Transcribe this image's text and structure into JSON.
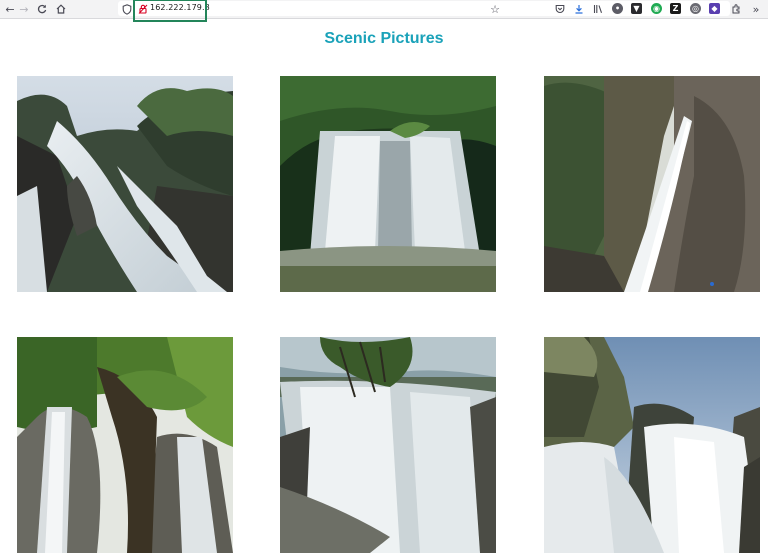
{
  "browser": {
    "url": "162.222.179.8",
    "nav_icons": [
      "back-arrow-icon",
      "forward-arrow-icon",
      "reload-icon",
      "home-icon"
    ],
    "toolbar_icons": [
      "shield-icon",
      "lock-icon",
      "bookmark-star-icon",
      "pocket-icon",
      "downloads-icon",
      "library-icon",
      "extension-icons",
      "overflow-chevron-icon"
    ],
    "colors": {
      "highlight_border": "#23855a"
    }
  },
  "page": {
    "title": "Scenic Pictures",
    "title_color": "#1aa2b9",
    "images": [
      {
        "name": "waterfall-image-1",
        "subject": "cascading waterfall over dark rocks with trees"
      },
      {
        "name": "waterfall-image-2",
        "subject": "wide waterfall in green forest with pool"
      },
      {
        "name": "waterfall-image-3",
        "subject": "tall narrow waterfall beside rock cliff"
      },
      {
        "name": "waterfall-image-4",
        "subject": "waterfall behind large tree branches"
      },
      {
        "name": "waterfall-image-5",
        "subject": "broad waterfall viewed from above with branches"
      },
      {
        "name": "waterfall-image-6",
        "subject": "waterfall rushing between rocks under sky"
      }
    ]
  }
}
